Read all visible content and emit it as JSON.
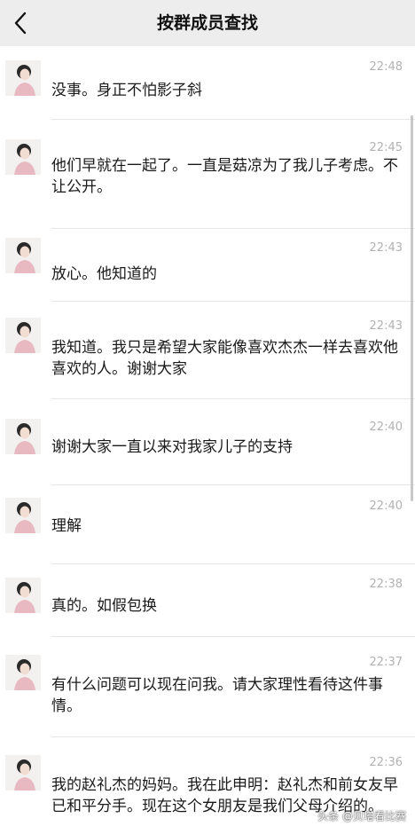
{
  "header": {
    "title": "按群成员查找"
  },
  "messages": [
    {
      "time": "22:48",
      "text": "没事。身正不怕影子斜"
    },
    {
      "time": "22:45",
      "text": "他们早就在一起了。一直是菇凉为了我儿子考虑。不让公开。"
    },
    {
      "time": "22:43",
      "text": "放心。他知道的"
    },
    {
      "time": "22:43",
      "text": "我知道。我只是希望大家能像喜欢杰杰一样去喜欢他喜欢的人。谢谢大家"
    },
    {
      "time": "22:40",
      "text": "谢谢大家一直以来对我家儿子的支持"
    },
    {
      "time": "22:40",
      "text": "理解"
    },
    {
      "time": "22:38",
      "text": "真的。如假包换"
    },
    {
      "time": "22:37",
      "text": "有什么问题可以现在问我。请大家理性看待这件事情。"
    },
    {
      "time": "22:36",
      "text": "我的赵礼杰的妈妈。我在此申明：赵礼杰和前女友早已和平分手。现在这个女朋友是我们父母介绍的。"
    }
  ],
  "watermark": "头条 @贝塔看比赛",
  "colors": {
    "header_bg": "#ededed",
    "time": "#b2b2b2",
    "separator": "#e6e6e6"
  }
}
